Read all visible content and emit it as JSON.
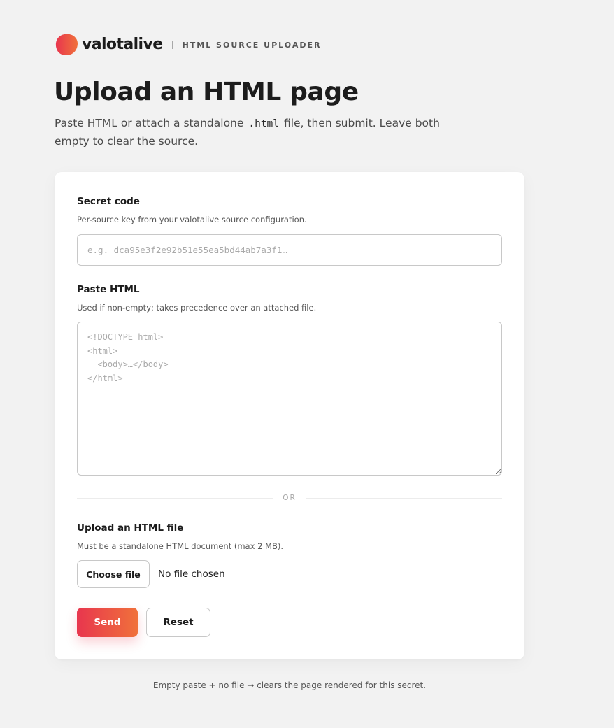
{
  "brand": {
    "name": "valotalive",
    "subtitle": "HTML SOURCE UPLOADER",
    "colors": {
      "gradient_start": "#e8364e",
      "gradient_end": "#f0713b"
    }
  },
  "header": {
    "title": "Upload an HTML page",
    "intro_before": "Paste HTML or attach a standalone ",
    "intro_code": ".html",
    "intro_after": " file, then submit. Leave both empty to clear the source."
  },
  "form": {
    "secret": {
      "label": "Secret code",
      "help": "Per-source key from your valotalive source configuration.",
      "placeholder": "e.g. dca95e3f2e92b51e55ea5bd44ab7a3f1…",
      "value": ""
    },
    "paste": {
      "label": "Paste HTML",
      "help": "Used if non-empty; takes precedence over an attached file.",
      "placeholder": "<!DOCTYPE html>\n<html>\n  <body>…</body>\n</html>",
      "value": ""
    },
    "divider_label": "OR",
    "upload": {
      "label": "Upload an HTML file",
      "help": "Must be a standalone HTML document (max 2 MB).",
      "button_label": "Choose file",
      "status": "No file chosen"
    },
    "send_label": "Send",
    "reset_label": "Reset"
  },
  "footer": {
    "note": "Empty paste + no file → clears the page rendered for this secret."
  }
}
